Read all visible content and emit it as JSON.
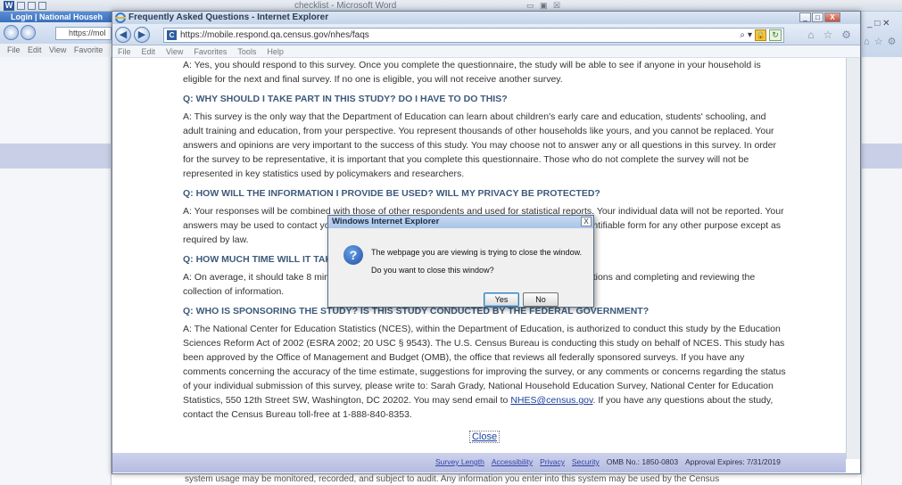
{
  "word": {
    "title": "checklist - Microsoft Word",
    "logo": "W",
    "window_controls": "▭ ▣ ☒"
  },
  "bg_left_ie": {
    "tab_label": "Login | National Househ",
    "address": "https://mol",
    "menu": "File Edit View Favorite"
  },
  "bg_bottom_text": "system usage may be monitored, recorded, and subject to audit. Any information you enter into this system may be used by the Census",
  "ie": {
    "title": "Frequently Asked Questions - Internet Explorer",
    "address": "https://mobile.respond.qa.census.gov/nhes/faqs",
    "menu": [
      "File",
      "Edit",
      "View",
      "Favorites",
      "Tools",
      "Help"
    ],
    "window_buttons": {
      "minimize": "_",
      "maximize": "□",
      "close": "X"
    }
  },
  "faq": {
    "intro_answer": "A: Yes, you should respond to this survey. Once you complete the questionnaire, the study will be able to see if anyone in your household is eligible for the next and final survey. If no one is eligible, you will not receive another survey.",
    "q1": "Q: WHY SHOULD I TAKE PART IN THIS STUDY? DO I HAVE TO DO THIS?",
    "a1": "A: This survey is the only way that the Department of Education can learn about children's early care and education, students' schooling, and adult training and education, from your perspective. You represent thousands of other households like yours, and you cannot be replaced. Your answers and opinions are very important to the success of this study. You may choose not to answer any or all questions in this survey. In order for the survey to be representative, it is important that you complete this questionnaire. Those who do not complete the survey will not be represented in key statistics used by policymakers and researchers.",
    "q2": "Q: HOW WILL THE INFORMATION I PROVIDE BE USED? WILL MY PRIVACY BE PROTECTED?",
    "a2": "A: Your responses will be combined with those of other respondents and used for statistical reports. Your individual data will not be reported. Your answers may be used to contact you about the next survey and will not be disclosed or used, in identifiable form for any other purpose except as required by law.",
    "q3": "Q: HOW MUCH TIME WILL IT TAKE?",
    "a3": "A: On average, it should take 8 minutes to complete this survey, including time for reviewing instructions and completing and reviewing the collection of information.",
    "q4": "Q: WHO IS SPONSORING THE STUDY? IS THIS STUDY CONDUCTED BY THE FEDERAL GOVERNMENT?",
    "a4": "A: The National Center for Education Statistics (NCES), within the Department of Education, is authorized to conduct this study by the Education Sciences Reform Act of 2002 (ESRA 2002; 20 USC § 9543). The U.S. Census Bureau is conducting this study on behalf of NCES. This study has been approved by the Office of Management and Budget (OMB), the office that reviews all federally sponsored surveys. If you have any comments concerning the accuracy of the time estimate, suggestions for improving the survey, or any comments or concerns regarding the status of your individual submission of this survey, please write to: Sarah Grady, National Household Education Survey, National Center for Education Statistics, 550 12th Street SW, Washington, DC 20202. You may send email to",
    "email": "NHES@census.gov",
    "a4_tail": "If you have any questions about the study, contact the Census Bureau toll-free at 1-888-840-8353.",
    "close": "Close"
  },
  "footer": {
    "links": [
      "Survey Length",
      "Accessibility",
      "Privacy",
      "Security"
    ],
    "omb": "OMB No.: 1850-0803",
    "expires": "Approval Expires: 7/31/2019"
  },
  "dialog": {
    "title": "Windows Internet Explorer",
    "message1": "The webpage you are viewing is trying to close the window.",
    "message2": "Do you want to close this window?",
    "yes": "Yes",
    "no": "No",
    "icon": "question-icon"
  },
  "colors": {
    "question_heading": "#3c5a7a",
    "link": "#1b3f9e",
    "footer_band": "#b4bbe0"
  }
}
